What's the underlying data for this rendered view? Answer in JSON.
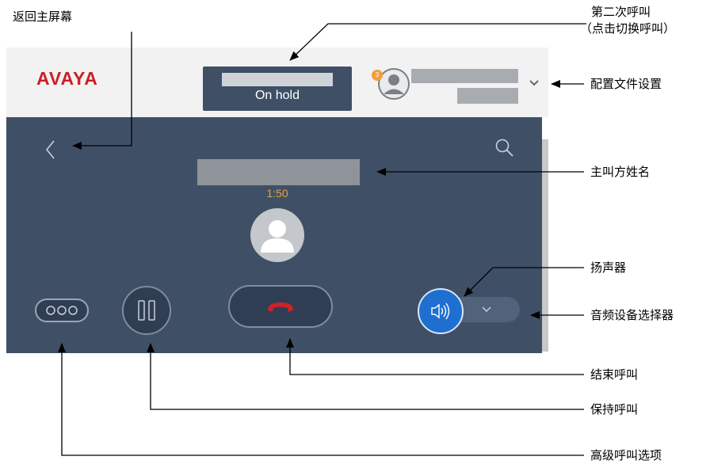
{
  "app": {
    "logo": "AVAYA",
    "held_call": {
      "status": "On hold"
    },
    "profile": {
      "badge_count": "3"
    },
    "active_call": {
      "timer": "1:50"
    }
  },
  "callouts": {
    "home": "返回主屏幕",
    "second_call_line1": "第二次呼叫",
    "second_call_line2": "（点击切换呼叫）",
    "profile_settings": "配置文件设置",
    "caller_name": "主叫方姓名",
    "speaker": "扬声器",
    "audio_selector": "音频设备选择器",
    "end_call": "结束呼叫",
    "hold_call": "保持呼叫",
    "advanced_options": "高级呼叫选项"
  },
  "colors": {
    "panel": "#3f5066",
    "logo_red": "#cc1e25",
    "timer": "#e8a23c",
    "speaker_blue": "#1f6fd1",
    "end_red": "#d0202a"
  }
}
